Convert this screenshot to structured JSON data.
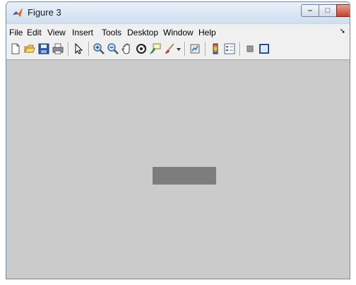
{
  "window": {
    "title": "Figure 3",
    "controls": {
      "minimize": "–",
      "maximize": "□",
      "close": "X"
    }
  },
  "menubar": {
    "items": [
      "File",
      "Edit",
      "View",
      "Insert",
      "Tools",
      "Desktop",
      "Window",
      "Help"
    ],
    "overflow": "➘"
  },
  "toolbar": {
    "buttons": [
      "new-figure-icon",
      "open-file-icon",
      "save-icon",
      "print-icon",
      "edit-plot-arrow-icon",
      "zoom-in-icon",
      "zoom-out-icon",
      "pan-hand-icon",
      "rotate-3d-icon",
      "data-cursor-icon",
      "brush-icon",
      "brush-dropdown-icon",
      "link-plot-icon",
      "colorbar-icon",
      "legend-icon",
      "hide-plot-tools-icon",
      "show-plot-tools-icon"
    ]
  },
  "colors": {
    "canvas_background": "#cbcbcb",
    "image_patch": "#7d7d7d"
  }
}
